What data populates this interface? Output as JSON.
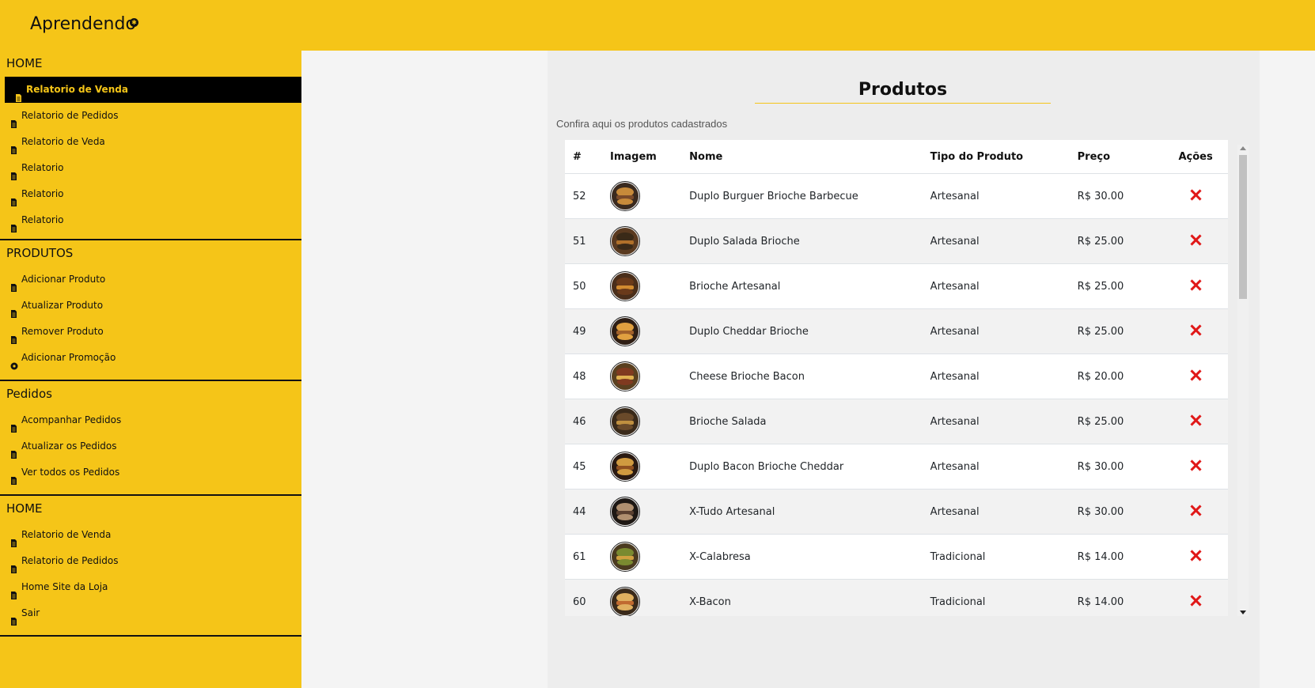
{
  "app": {
    "brand": "Aprendendo",
    "colors": {
      "accent": "#f5c518",
      "active_bg": "#000000",
      "delete": "#e01818"
    }
  },
  "sidebar": {
    "sections": [
      {
        "header": "HOME",
        "items": [
          {
            "label": "Relatorio de Venda",
            "icon": "document-icon",
            "active": true
          },
          {
            "label": "Relatorio de Pedidos",
            "icon": "document-icon"
          },
          {
            "label": "Relatorio de Veda",
            "icon": "document-icon"
          },
          {
            "label": "Relatorio",
            "icon": "document-icon"
          },
          {
            "label": "Relatorio",
            "icon": "document-icon"
          },
          {
            "label": "Relatorio",
            "icon": "document-icon"
          }
        ]
      },
      {
        "header": "PRODUTOS",
        "items": [
          {
            "label": "Adicionar Produto",
            "icon": "document-icon"
          },
          {
            "label": "Atualizar Produto",
            "icon": "document-icon"
          },
          {
            "label": "Remover Produto",
            "icon": "document-icon"
          },
          {
            "label": "Adicionar Promoção",
            "icon": "gear-icon"
          }
        ]
      },
      {
        "header": "Pedidos",
        "items": [
          {
            "label": "Acompanhar Pedidos",
            "icon": "document-icon"
          },
          {
            "label": "Atualizar os Pedidos",
            "icon": "document-icon"
          },
          {
            "label": "Ver todos os Pedidos",
            "icon": "document-icon"
          }
        ]
      },
      {
        "header": "HOME",
        "items": [
          {
            "label": "Relatorio de Venda",
            "icon": "document-icon"
          },
          {
            "label": "Relatorio de Pedidos",
            "icon": "document-icon"
          },
          {
            "label": "Home Site da Loja",
            "icon": "document-icon"
          },
          {
            "label": "Sair",
            "icon": "document-icon"
          }
        ]
      }
    ]
  },
  "main": {
    "title": "Produtos",
    "subtitle": "Confira aqui os produtos cadastrados",
    "table": {
      "headers": [
        "#",
        "Imagem",
        "Nome",
        "Tipo do Produto",
        "Preço",
        "Ações"
      ],
      "rows": [
        {
          "id": "52",
          "name": "Duplo Burguer Brioche Barbecue",
          "type": "Artesanal",
          "price": "R$ 30.00"
        },
        {
          "id": "51",
          "name": "Duplo Salada Brioche",
          "type": "Artesanal",
          "price": "R$ 25.00"
        },
        {
          "id": "50",
          "name": "Brioche Artesanal",
          "type": "Artesanal",
          "price": "R$ 25.00"
        },
        {
          "id": "49",
          "name": "Duplo Cheddar Brioche",
          "type": "Artesanal",
          "price": "R$ 25.00"
        },
        {
          "id": "48",
          "name": "Cheese Brioche Bacon",
          "type": "Artesanal",
          "price": "R$ 20.00"
        },
        {
          "id": "46",
          "name": "Brioche Salada",
          "type": "Artesanal",
          "price": "R$ 25.00"
        },
        {
          "id": "45",
          "name": "Duplo Bacon Brioche Cheddar",
          "type": "Artesanal",
          "price": "R$ 30.00"
        },
        {
          "id": "44",
          "name": "X-Tudo Artesanal",
          "type": "Artesanal",
          "price": "R$ 30.00"
        },
        {
          "id": "61",
          "name": "X-Calabresa",
          "type": "Tradicional",
          "price": "R$ 14.00"
        },
        {
          "id": "60",
          "name": "X-Bacon",
          "type": "Tradicional",
          "price": "R$ 14.00"
        }
      ]
    }
  }
}
